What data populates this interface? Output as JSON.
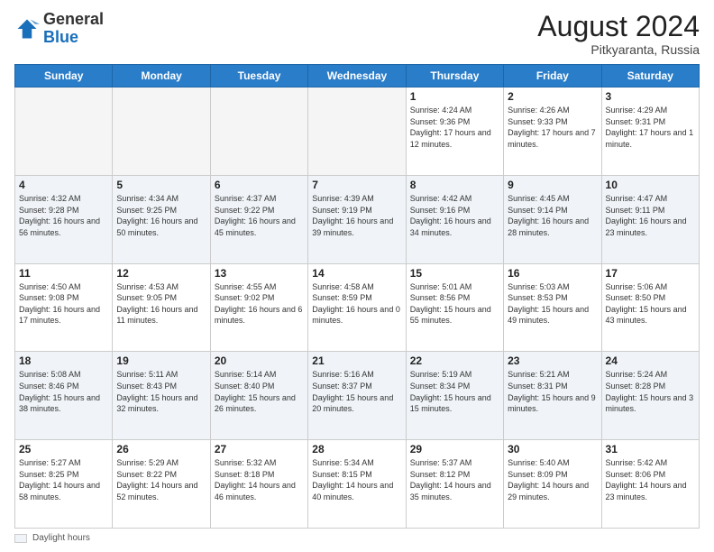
{
  "header": {
    "logo_general": "General",
    "logo_blue": "Blue",
    "month_title": "August 2024",
    "subtitle": "Pitkyaranta, Russia"
  },
  "days_of_week": [
    "Sunday",
    "Monday",
    "Tuesday",
    "Wednesday",
    "Thursday",
    "Friday",
    "Saturday"
  ],
  "footer": {
    "label": "Daylight hours"
  },
  "weeks": [
    [
      {
        "day": "",
        "sunrise": "",
        "sunset": "",
        "daylight": "",
        "empty": true
      },
      {
        "day": "",
        "sunrise": "",
        "sunset": "",
        "daylight": "",
        "empty": true
      },
      {
        "day": "",
        "sunrise": "",
        "sunset": "",
        "daylight": "",
        "empty": true
      },
      {
        "day": "",
        "sunrise": "",
        "sunset": "",
        "daylight": "",
        "empty": true
      },
      {
        "day": "1",
        "sunrise": "Sunrise: 4:24 AM",
        "sunset": "Sunset: 9:36 PM",
        "daylight": "Daylight: 17 hours and 12 minutes.",
        "empty": false
      },
      {
        "day": "2",
        "sunrise": "Sunrise: 4:26 AM",
        "sunset": "Sunset: 9:33 PM",
        "daylight": "Daylight: 17 hours and 7 minutes.",
        "empty": false
      },
      {
        "day": "3",
        "sunrise": "Sunrise: 4:29 AM",
        "sunset": "Sunset: 9:31 PM",
        "daylight": "Daylight: 17 hours and 1 minute.",
        "empty": false
      }
    ],
    [
      {
        "day": "4",
        "sunrise": "Sunrise: 4:32 AM",
        "sunset": "Sunset: 9:28 PM",
        "daylight": "Daylight: 16 hours and 56 minutes.",
        "empty": false
      },
      {
        "day": "5",
        "sunrise": "Sunrise: 4:34 AM",
        "sunset": "Sunset: 9:25 PM",
        "daylight": "Daylight: 16 hours and 50 minutes.",
        "empty": false
      },
      {
        "day": "6",
        "sunrise": "Sunrise: 4:37 AM",
        "sunset": "Sunset: 9:22 PM",
        "daylight": "Daylight: 16 hours and 45 minutes.",
        "empty": false
      },
      {
        "day": "7",
        "sunrise": "Sunrise: 4:39 AM",
        "sunset": "Sunset: 9:19 PM",
        "daylight": "Daylight: 16 hours and 39 minutes.",
        "empty": false
      },
      {
        "day": "8",
        "sunrise": "Sunrise: 4:42 AM",
        "sunset": "Sunset: 9:16 PM",
        "daylight": "Daylight: 16 hours and 34 minutes.",
        "empty": false
      },
      {
        "day": "9",
        "sunrise": "Sunrise: 4:45 AM",
        "sunset": "Sunset: 9:14 PM",
        "daylight": "Daylight: 16 hours and 28 minutes.",
        "empty": false
      },
      {
        "day": "10",
        "sunrise": "Sunrise: 4:47 AM",
        "sunset": "Sunset: 9:11 PM",
        "daylight": "Daylight: 16 hours and 23 minutes.",
        "empty": false
      }
    ],
    [
      {
        "day": "11",
        "sunrise": "Sunrise: 4:50 AM",
        "sunset": "Sunset: 9:08 PM",
        "daylight": "Daylight: 16 hours and 17 minutes.",
        "empty": false
      },
      {
        "day": "12",
        "sunrise": "Sunrise: 4:53 AM",
        "sunset": "Sunset: 9:05 PM",
        "daylight": "Daylight: 16 hours and 11 minutes.",
        "empty": false
      },
      {
        "day": "13",
        "sunrise": "Sunrise: 4:55 AM",
        "sunset": "Sunset: 9:02 PM",
        "daylight": "Daylight: 16 hours and 6 minutes.",
        "empty": false
      },
      {
        "day": "14",
        "sunrise": "Sunrise: 4:58 AM",
        "sunset": "Sunset: 8:59 PM",
        "daylight": "Daylight: 16 hours and 0 minutes.",
        "empty": false
      },
      {
        "day": "15",
        "sunrise": "Sunrise: 5:01 AM",
        "sunset": "Sunset: 8:56 PM",
        "daylight": "Daylight: 15 hours and 55 minutes.",
        "empty": false
      },
      {
        "day": "16",
        "sunrise": "Sunrise: 5:03 AM",
        "sunset": "Sunset: 8:53 PM",
        "daylight": "Daylight: 15 hours and 49 minutes.",
        "empty": false
      },
      {
        "day": "17",
        "sunrise": "Sunrise: 5:06 AM",
        "sunset": "Sunset: 8:50 PM",
        "daylight": "Daylight: 15 hours and 43 minutes.",
        "empty": false
      }
    ],
    [
      {
        "day": "18",
        "sunrise": "Sunrise: 5:08 AM",
        "sunset": "Sunset: 8:46 PM",
        "daylight": "Daylight: 15 hours and 38 minutes.",
        "empty": false
      },
      {
        "day": "19",
        "sunrise": "Sunrise: 5:11 AM",
        "sunset": "Sunset: 8:43 PM",
        "daylight": "Daylight: 15 hours and 32 minutes.",
        "empty": false
      },
      {
        "day": "20",
        "sunrise": "Sunrise: 5:14 AM",
        "sunset": "Sunset: 8:40 PM",
        "daylight": "Daylight: 15 hours and 26 minutes.",
        "empty": false
      },
      {
        "day": "21",
        "sunrise": "Sunrise: 5:16 AM",
        "sunset": "Sunset: 8:37 PM",
        "daylight": "Daylight: 15 hours and 20 minutes.",
        "empty": false
      },
      {
        "day": "22",
        "sunrise": "Sunrise: 5:19 AM",
        "sunset": "Sunset: 8:34 PM",
        "daylight": "Daylight: 15 hours and 15 minutes.",
        "empty": false
      },
      {
        "day": "23",
        "sunrise": "Sunrise: 5:21 AM",
        "sunset": "Sunset: 8:31 PM",
        "daylight": "Daylight: 15 hours and 9 minutes.",
        "empty": false
      },
      {
        "day": "24",
        "sunrise": "Sunrise: 5:24 AM",
        "sunset": "Sunset: 8:28 PM",
        "daylight": "Daylight: 15 hours and 3 minutes.",
        "empty": false
      }
    ],
    [
      {
        "day": "25",
        "sunrise": "Sunrise: 5:27 AM",
        "sunset": "Sunset: 8:25 PM",
        "daylight": "Daylight: 14 hours and 58 minutes.",
        "empty": false
      },
      {
        "day": "26",
        "sunrise": "Sunrise: 5:29 AM",
        "sunset": "Sunset: 8:22 PM",
        "daylight": "Daylight: 14 hours and 52 minutes.",
        "empty": false
      },
      {
        "day": "27",
        "sunrise": "Sunrise: 5:32 AM",
        "sunset": "Sunset: 8:18 PM",
        "daylight": "Daylight: 14 hours and 46 minutes.",
        "empty": false
      },
      {
        "day": "28",
        "sunrise": "Sunrise: 5:34 AM",
        "sunset": "Sunset: 8:15 PM",
        "daylight": "Daylight: 14 hours and 40 minutes.",
        "empty": false
      },
      {
        "day": "29",
        "sunrise": "Sunrise: 5:37 AM",
        "sunset": "Sunset: 8:12 PM",
        "daylight": "Daylight: 14 hours and 35 minutes.",
        "empty": false
      },
      {
        "day": "30",
        "sunrise": "Sunrise: 5:40 AM",
        "sunset": "Sunset: 8:09 PM",
        "daylight": "Daylight: 14 hours and 29 minutes.",
        "empty": false
      },
      {
        "day": "31",
        "sunrise": "Sunrise: 5:42 AM",
        "sunset": "Sunset: 8:06 PM",
        "daylight": "Daylight: 14 hours and 23 minutes.",
        "empty": false
      }
    ]
  ]
}
